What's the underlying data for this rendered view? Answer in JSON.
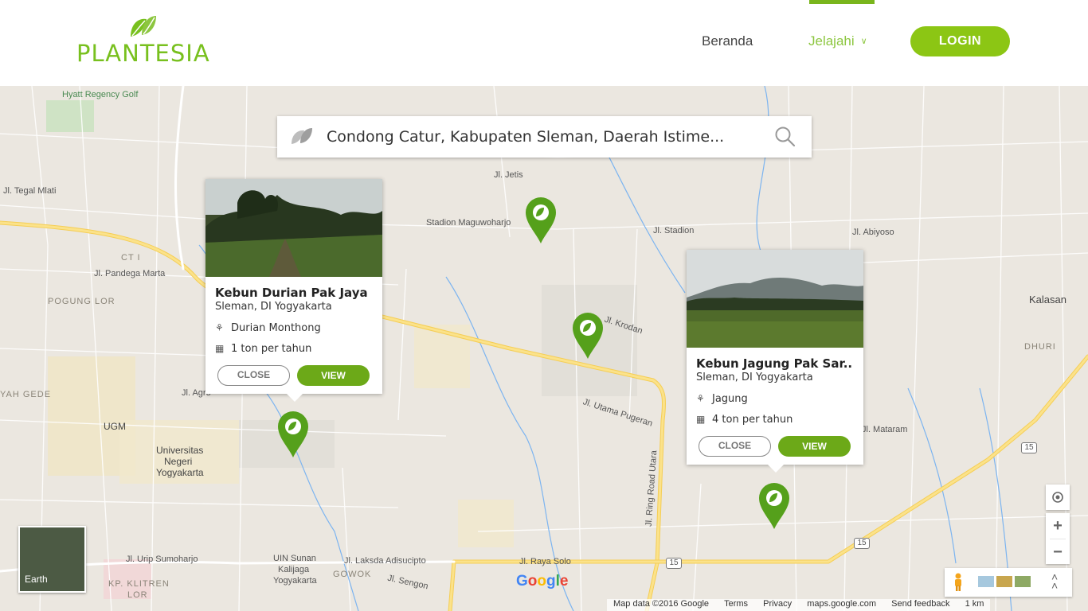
{
  "brand": {
    "name": "PLANTESIA",
    "color": "#78c01e"
  },
  "nav": {
    "home_label": "Beranda",
    "explore_label": "Jelajahi",
    "login_label": "LOGIN"
  },
  "search": {
    "value": "Condong Catur, Kabupaten Sleman, Daerah Istime..."
  },
  "cards": [
    {
      "title": "Kebun Durian Pak Jaya",
      "location": "Sleman, DI Yogyakarta",
      "plant": "Durian Monthong",
      "yield": "1 ton per tahun",
      "close_label": "CLOSE",
      "view_label": "VIEW"
    },
    {
      "title": "Kebun Jagung Pak Sar..",
      "location": "Sleman, DI Yogyakarta",
      "plant": "Jagung",
      "yield": "4 ton per tahun",
      "close_label": "CLOSE",
      "view_label": "VIEW"
    }
  ],
  "map_labels": {
    "hyatt": "Hyatt Regency Golf",
    "stadion": "Stadion Maguwoharjo",
    "jl_stadion": "Jl. Stadion",
    "jl_abiyoso": "Jl. Abiyoso",
    "jl_jetis": "Jl. Jetis",
    "jl_tegal_mlati": "Jl. Tegal Mlati",
    "ct1": "CT I",
    "pandega": "Jl. Pandega Marta",
    "pogung": "POGUNG LOR",
    "ugm": "UGM",
    "uny1": "Universitas",
    "uny2": "Negeri",
    "uny3": "Yogyakarta",
    "jl_agro": "Jl. Agro",
    "kalasan": "Kalasan",
    "dhuri": "DHURI",
    "mataram": "Jl. Mataram",
    "utama_pugeran": "Jl. Utama Pugeran",
    "ring_road": "Jl. Ring Road Utara",
    "raya_solo": "Jl. Raya Solo",
    "laksda": "Jl. Laksda Adisucipto",
    "urip": "Jl. Urip Sumoharjo",
    "uin1": "UIN Sunan",
    "uin2": "Kalijaga",
    "uin3": "Yogyakarta",
    "gowok": "GOWOK",
    "klitren1": "KP. KLITREN",
    "klitren2": "LOR",
    "sengon": "Jl. Sengon",
    "krodan": "Jl. Krodan",
    "yah_gede": "YAH GEDE",
    "route15": "15"
  },
  "map_ui": {
    "earth_label": "Earth",
    "google": "Google",
    "attribution": [
      "Map data ©2016 Google",
      "Terms",
      "Privacy",
      "maps.google.com",
      "Send feedback",
      "1 km"
    ]
  }
}
